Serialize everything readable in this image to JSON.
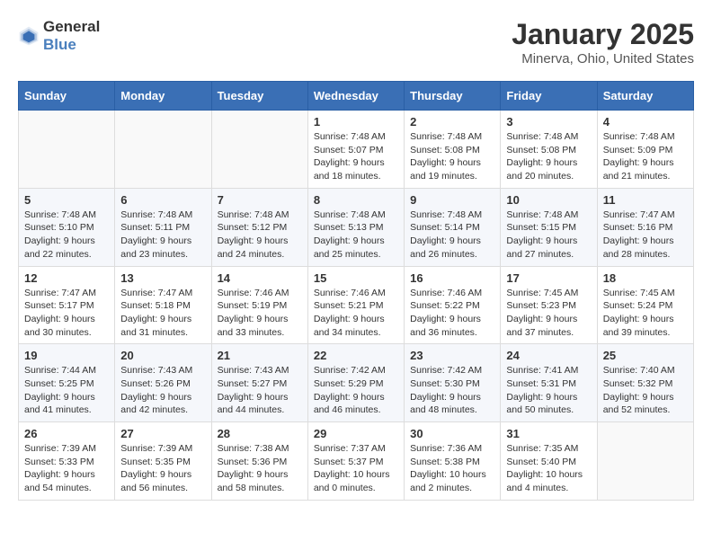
{
  "header": {
    "logo": {
      "general": "General",
      "blue": "Blue"
    },
    "title": "January 2025",
    "location": "Minerva, Ohio, United States"
  },
  "calendar": {
    "weekdays": [
      "Sunday",
      "Monday",
      "Tuesday",
      "Wednesday",
      "Thursday",
      "Friday",
      "Saturday"
    ],
    "weeks": [
      [
        {
          "day": "",
          "info": ""
        },
        {
          "day": "",
          "info": ""
        },
        {
          "day": "",
          "info": ""
        },
        {
          "day": "1",
          "info": "Sunrise: 7:48 AM\nSunset: 5:07 PM\nDaylight: 9 hours and 18 minutes."
        },
        {
          "day": "2",
          "info": "Sunrise: 7:48 AM\nSunset: 5:08 PM\nDaylight: 9 hours and 19 minutes."
        },
        {
          "day": "3",
          "info": "Sunrise: 7:48 AM\nSunset: 5:08 PM\nDaylight: 9 hours and 20 minutes."
        },
        {
          "day": "4",
          "info": "Sunrise: 7:48 AM\nSunset: 5:09 PM\nDaylight: 9 hours and 21 minutes."
        }
      ],
      [
        {
          "day": "5",
          "info": "Sunrise: 7:48 AM\nSunset: 5:10 PM\nDaylight: 9 hours and 22 minutes."
        },
        {
          "day": "6",
          "info": "Sunrise: 7:48 AM\nSunset: 5:11 PM\nDaylight: 9 hours and 23 minutes."
        },
        {
          "day": "7",
          "info": "Sunrise: 7:48 AM\nSunset: 5:12 PM\nDaylight: 9 hours and 24 minutes."
        },
        {
          "day": "8",
          "info": "Sunrise: 7:48 AM\nSunset: 5:13 PM\nDaylight: 9 hours and 25 minutes."
        },
        {
          "day": "9",
          "info": "Sunrise: 7:48 AM\nSunset: 5:14 PM\nDaylight: 9 hours and 26 minutes."
        },
        {
          "day": "10",
          "info": "Sunrise: 7:48 AM\nSunset: 5:15 PM\nDaylight: 9 hours and 27 minutes."
        },
        {
          "day": "11",
          "info": "Sunrise: 7:47 AM\nSunset: 5:16 PM\nDaylight: 9 hours and 28 minutes."
        }
      ],
      [
        {
          "day": "12",
          "info": "Sunrise: 7:47 AM\nSunset: 5:17 PM\nDaylight: 9 hours and 30 minutes."
        },
        {
          "day": "13",
          "info": "Sunrise: 7:47 AM\nSunset: 5:18 PM\nDaylight: 9 hours and 31 minutes."
        },
        {
          "day": "14",
          "info": "Sunrise: 7:46 AM\nSunset: 5:19 PM\nDaylight: 9 hours and 33 minutes."
        },
        {
          "day": "15",
          "info": "Sunrise: 7:46 AM\nSunset: 5:21 PM\nDaylight: 9 hours and 34 minutes."
        },
        {
          "day": "16",
          "info": "Sunrise: 7:46 AM\nSunset: 5:22 PM\nDaylight: 9 hours and 36 minutes."
        },
        {
          "day": "17",
          "info": "Sunrise: 7:45 AM\nSunset: 5:23 PM\nDaylight: 9 hours and 37 minutes."
        },
        {
          "day": "18",
          "info": "Sunrise: 7:45 AM\nSunset: 5:24 PM\nDaylight: 9 hours and 39 minutes."
        }
      ],
      [
        {
          "day": "19",
          "info": "Sunrise: 7:44 AM\nSunset: 5:25 PM\nDaylight: 9 hours and 41 minutes."
        },
        {
          "day": "20",
          "info": "Sunrise: 7:43 AM\nSunset: 5:26 PM\nDaylight: 9 hours and 42 minutes."
        },
        {
          "day": "21",
          "info": "Sunrise: 7:43 AM\nSunset: 5:27 PM\nDaylight: 9 hours and 44 minutes."
        },
        {
          "day": "22",
          "info": "Sunrise: 7:42 AM\nSunset: 5:29 PM\nDaylight: 9 hours and 46 minutes."
        },
        {
          "day": "23",
          "info": "Sunrise: 7:42 AM\nSunset: 5:30 PM\nDaylight: 9 hours and 48 minutes."
        },
        {
          "day": "24",
          "info": "Sunrise: 7:41 AM\nSunset: 5:31 PM\nDaylight: 9 hours and 50 minutes."
        },
        {
          "day": "25",
          "info": "Sunrise: 7:40 AM\nSunset: 5:32 PM\nDaylight: 9 hours and 52 minutes."
        }
      ],
      [
        {
          "day": "26",
          "info": "Sunrise: 7:39 AM\nSunset: 5:33 PM\nDaylight: 9 hours and 54 minutes."
        },
        {
          "day": "27",
          "info": "Sunrise: 7:39 AM\nSunset: 5:35 PM\nDaylight: 9 hours and 56 minutes."
        },
        {
          "day": "28",
          "info": "Sunrise: 7:38 AM\nSunset: 5:36 PM\nDaylight: 9 hours and 58 minutes."
        },
        {
          "day": "29",
          "info": "Sunrise: 7:37 AM\nSunset: 5:37 PM\nDaylight: 10 hours and 0 minutes."
        },
        {
          "day": "30",
          "info": "Sunrise: 7:36 AM\nSunset: 5:38 PM\nDaylight: 10 hours and 2 minutes."
        },
        {
          "day": "31",
          "info": "Sunrise: 7:35 AM\nSunset: 5:40 PM\nDaylight: 10 hours and 4 minutes."
        },
        {
          "day": "",
          "info": ""
        }
      ]
    ]
  }
}
